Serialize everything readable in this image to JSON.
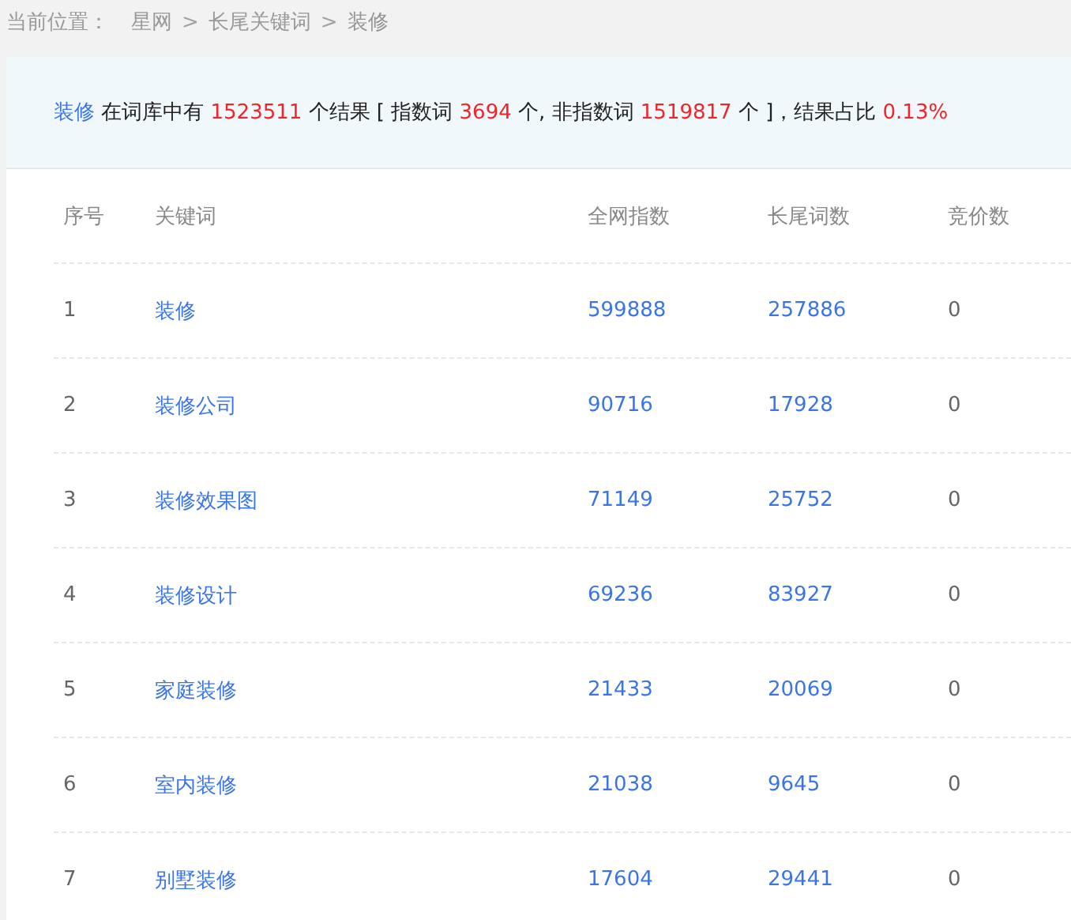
{
  "breadcrumb": {
    "label": "当前位置：",
    "items": [
      {
        "text": "星网",
        "kind": "link"
      },
      {
        "text": ">",
        "kind": "separator"
      },
      {
        "text": "长尾关键词",
        "kind": "link"
      },
      {
        "text": ">",
        "kind": "separator"
      },
      {
        "text": "装修",
        "kind": "current"
      }
    ]
  },
  "summary": [
    {
      "text": "装修",
      "kind": "keyword"
    },
    {
      "text": " 在词库中有 ",
      "kind": "text"
    },
    {
      "text": "1523511",
      "kind": "number"
    },
    {
      "text": " 个结果 [ 指数词 ",
      "kind": "text"
    },
    {
      "text": "3694",
      "kind": "number"
    },
    {
      "text": " 个, 非指数词 ",
      "kind": "text"
    },
    {
      "text": "1519817",
      "kind": "number"
    },
    {
      "text": " 个 ]，结果占比 ",
      "kind": "text"
    },
    {
      "text": "0.13%",
      "kind": "number"
    }
  ],
  "table": {
    "columns": [
      "序号",
      "关键词",
      "全网指数",
      "长尾词数",
      "竞价数"
    ],
    "rows": [
      [
        "1",
        "装修",
        "599888",
        "257886",
        "0"
      ],
      [
        "2",
        "装修公司",
        "90716",
        "17928",
        "0"
      ],
      [
        "3",
        "装修效果图",
        "71149",
        "25752",
        "0"
      ],
      [
        "4",
        "装修设计",
        "69236",
        "83927",
        "0"
      ],
      [
        "5",
        "家庭装修",
        "21433",
        "20069",
        "0"
      ],
      [
        "6",
        "室内装修",
        "21038",
        "9645",
        "0"
      ],
      [
        "7",
        "别墅装修",
        "17604",
        "29441",
        "0"
      ]
    ]
  }
}
